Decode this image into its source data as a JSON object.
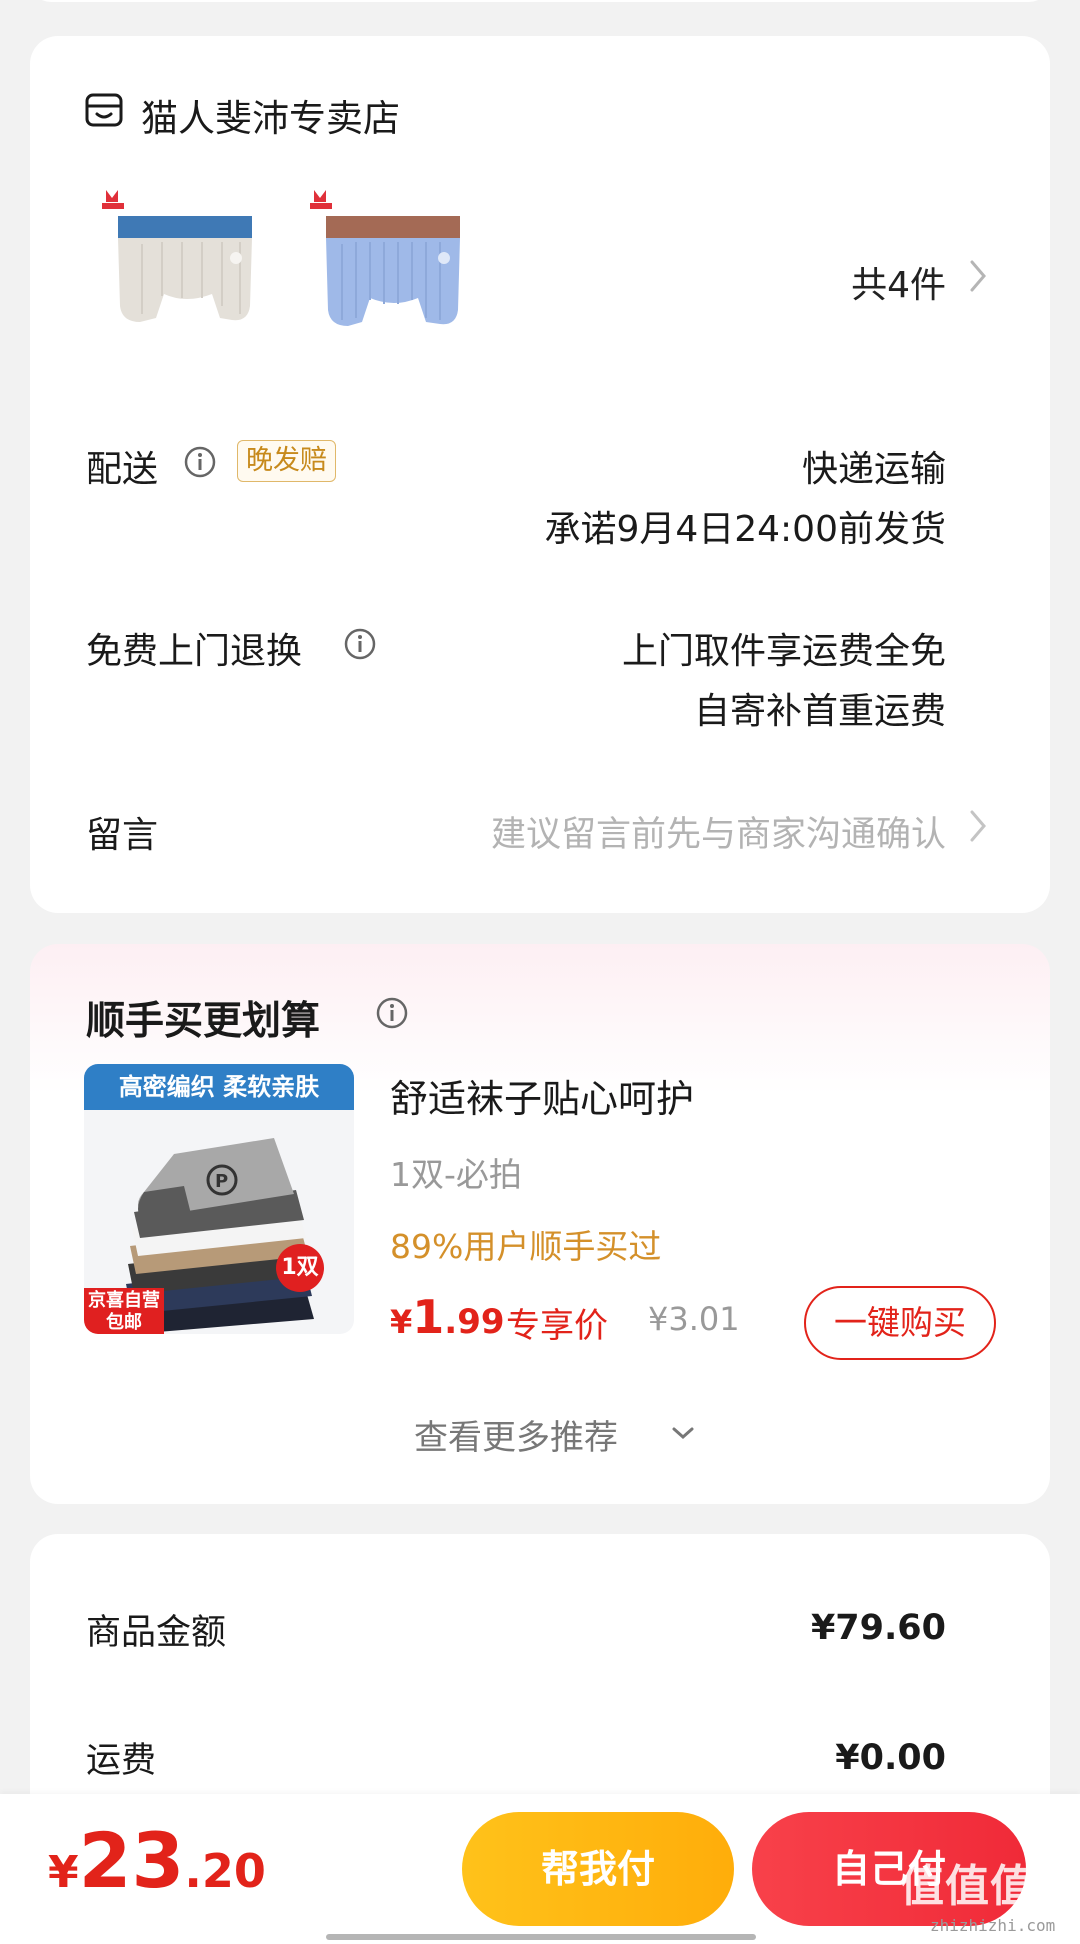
{
  "shop": {
    "name": "猫人斐沛专卖店",
    "item_count": "共4件"
  },
  "delivery": {
    "label": "配送",
    "badge": "晚发赔",
    "method": "快递运输",
    "promise": "承诺9月4日24:00前发货"
  },
  "returns": {
    "label": "免费上门退换",
    "line1": "上门取件享运费全免",
    "line2": "自寄补首重运费"
  },
  "message": {
    "label": "留言",
    "placeholder": "建议留言前先与商家沟通确认"
  },
  "recommend": {
    "title": "顺手买更划算",
    "image_banner": "高密编织 柔软亲肤",
    "image_tag_line1": "京喜自营",
    "image_tag_line2": "包邮",
    "image_qty": "1双",
    "product_name": "舒适袜子贴心呵护",
    "spec": "1双-必拍",
    "stat": "89%用户顺手买过",
    "price_currency": "¥",
    "price_int": "1",
    "price_dec": ".99",
    "exclusive_label": "专享价",
    "original_price": "¥3.01",
    "buy_button": "一键购买",
    "see_more": "查看更多推荐"
  },
  "totals": {
    "goods_label": "商品金额",
    "goods_value": "¥79.60",
    "shipping_label": "运费",
    "shipping_value": "¥0.00"
  },
  "bottom": {
    "currency": "¥",
    "total_int": "23",
    "total_dec": ".20",
    "help_pay": "帮我付",
    "self_pay": "自己付",
    "watermark": "值值值",
    "watermark_url": "zhizhizhi.com"
  },
  "colors": {
    "accent_red": "#e2231a",
    "accent_orange": "#d4902a",
    "help_button": "#ffb81a",
    "self_button": "#f23340"
  }
}
